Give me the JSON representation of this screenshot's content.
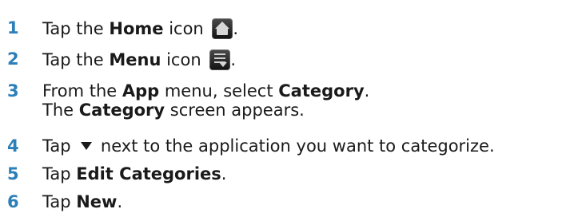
{
  "top_cropped_text": "",
  "steps": [
    {
      "number": "1",
      "parts": {
        "a": "Tap the ",
        "b": "Home",
        "c": " icon",
        "d": "."
      }
    },
    {
      "number": "2",
      "parts": {
        "a": "Tap the ",
        "b": "Menu",
        "c": " icon",
        "d": "."
      }
    },
    {
      "number": "3",
      "line1": {
        "a": "From the ",
        "b": "App",
        "c": " menu, select ",
        "d": "Category",
        "e": "."
      },
      "line2": {
        "a": "The ",
        "b": "Category",
        "c": " screen appears."
      }
    },
    {
      "number": "4",
      "parts": {
        "a": "Tap ",
        "b": " next to the application you want to categorize."
      }
    },
    {
      "number": "5",
      "parts": {
        "a": "Tap ",
        "b": "Edit Categories",
        "c": "."
      }
    },
    {
      "number": "6",
      "parts": {
        "a": "Tap ",
        "b": "New",
        "c": "."
      }
    }
  ],
  "colors": {
    "step_number": "#2c7fb8",
    "text": "#1a1a1a"
  },
  "icons": {
    "home": "home-icon",
    "menu": "menu-icon",
    "dropdown_triangle": "dropdown-triangle-icon"
  }
}
